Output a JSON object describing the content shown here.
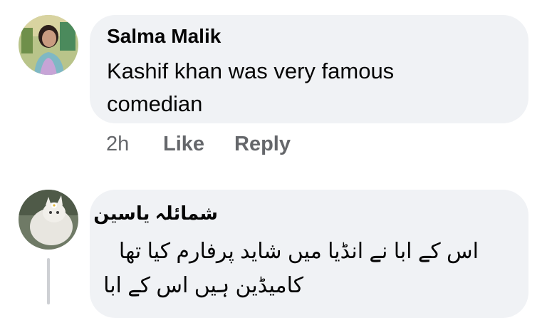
{
  "comments": [
    {
      "author": "Salma Malik",
      "text": "Kashif khan was very famous comedian",
      "time": "2h",
      "like_label": "Like",
      "reply_label": "Reply"
    },
    {
      "author": "شمائلہ یاسین",
      "text_line1": "اس کے ابا نے انڈیا میں شاید پرفارم کیا تھا",
      "text_line2": "کامیڈین ہیں اس کے ابا"
    }
  ]
}
